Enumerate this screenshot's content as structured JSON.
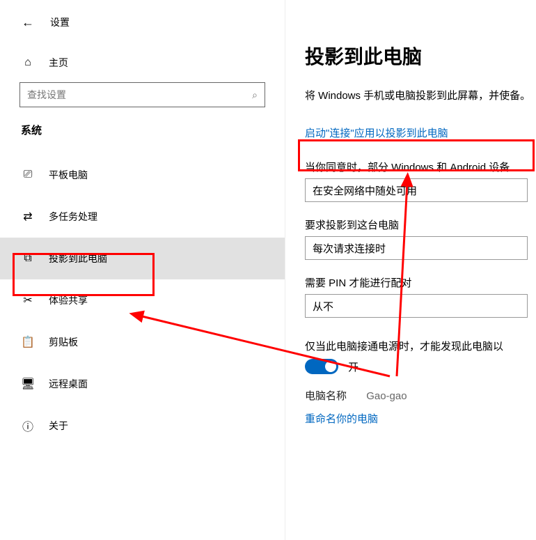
{
  "header": {
    "back_icon": "←",
    "title": "设置"
  },
  "home": {
    "icon": "⌂",
    "label": "主页"
  },
  "search": {
    "placeholder": "查找设置",
    "icon": "⌕"
  },
  "section_label": "系统",
  "nav": [
    {
      "icon": "⎚",
      "label": "平板电脑"
    },
    {
      "icon": "⇄",
      "label": "多任务处理"
    },
    {
      "icon": "⧉",
      "label": "投影到此电脑",
      "selected": true
    },
    {
      "icon": "✂",
      "label": "体验共享"
    },
    {
      "icon": "📋",
      "label": "剪贴板"
    },
    {
      "icon": "🖥",
      "label": "远程桌面"
    },
    {
      "icon": "ⓘ",
      "label": "关于"
    }
  ],
  "main": {
    "title": "投影到此电脑",
    "desc": "将 Windows 手机或电脑投影到此屏幕，并使备。",
    "link": "启动\"连接\"应用以投影到此电脑",
    "field1_label": "当你同意时，部分 Windows 和 Android 设备",
    "field1_value": "在安全网络中随处可用",
    "field2_label": "要求投影到这台电脑",
    "field2_value": "每次请求连接时",
    "field3_label": "需要 PIN 才能进行配对",
    "field3_value": "从不",
    "power_label": "仅当此电脑接通电源时，才能发现此电脑以",
    "toggle_label": "开",
    "pcname_key": "电脑名称",
    "pcname_val": "Gao-gao",
    "rename_link": "重命名你的电脑"
  }
}
